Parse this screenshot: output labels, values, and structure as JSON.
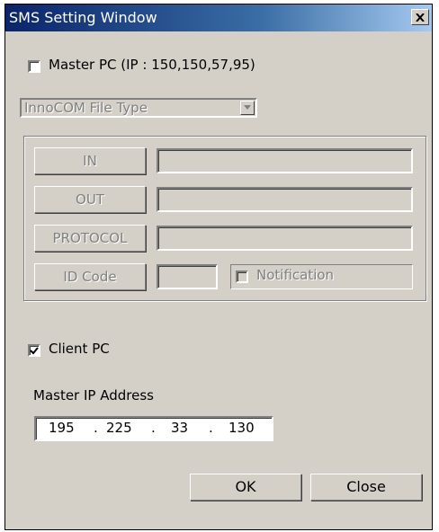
{
  "window": {
    "title": "SMS Setting Window",
    "close_glyph": "×"
  },
  "master": {
    "label": "Master PC (IP : 150,150,57,95)",
    "checked": false,
    "file_type": "InnoCOM File Type",
    "rows": [
      {
        "label": "IN",
        "value": ""
      },
      {
        "label": "OUT",
        "value": ""
      },
      {
        "label": "PROTOCOL",
        "value": ""
      }
    ],
    "id_code_label": "ID Code",
    "id_code_value": "",
    "notification_label": "Notification",
    "notification_checked": false
  },
  "client": {
    "label": "Client PC",
    "checked": true,
    "ip_label": "Master IP Address",
    "ip": [
      "195",
      "225",
      "33",
      "130"
    ],
    "ip_sep": "."
  },
  "buttons": {
    "ok": "OK",
    "close": "Close"
  }
}
